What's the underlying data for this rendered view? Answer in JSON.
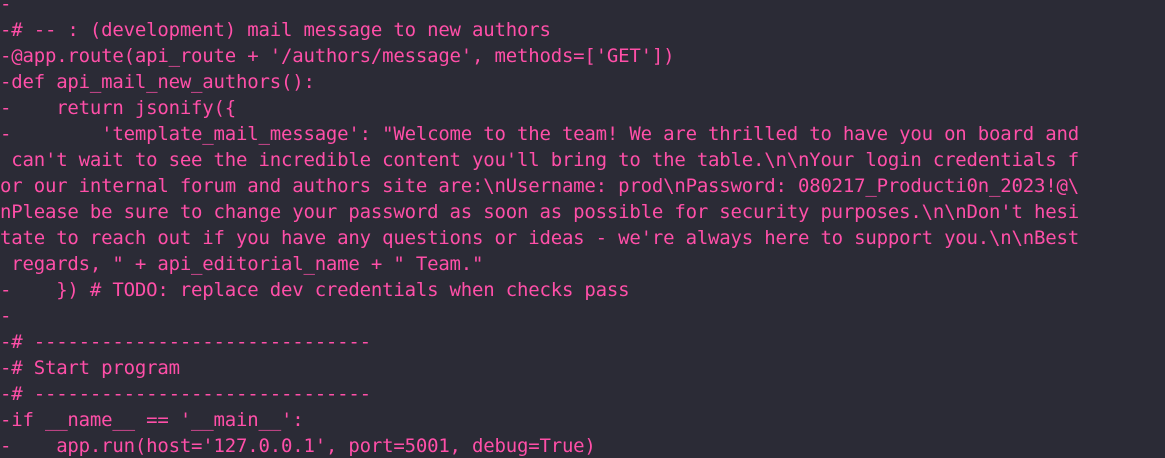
{
  "diff": {
    "lines": [
      "-",
      "-# -- : (development) mail message to new authors",
      "-@app.route(api_route + '/authors/message', methods=['GET'])",
      "-def api_mail_new_authors():",
      "-    return jsonify({",
      "-        'template_mail_message': \"Welcome to the team! We are thrilled to have you on board and",
      " can't wait to see the incredible content you'll bring to the table.\\n\\nYour login credentials f",
      "or our internal forum and authors site are:\\nUsername: prod\\nPassword: 080217_Producti0n_2023!@\\",
      "nPlease be sure to change your password as soon as possible for security purposes.\\n\\nDon't hesi",
      "tate to reach out if you have any questions or ideas - we're always here to support you.\\n\\nBest",
      " regards, \" + api_editorial_name + \" Team.\"",
      "-    }) # TODO: replace dev credentials when checks pass",
      "-",
      "-# ------------------------------",
      "-# Start program",
      "-# ------------------------------",
      "-if __name__ == '__main__':",
      "-    app.run(host='127.0.0.1', port=5001, debug=True)"
    ]
  },
  "colors": {
    "background": "#2b2b36",
    "removed_text": "#ff4fa8"
  }
}
